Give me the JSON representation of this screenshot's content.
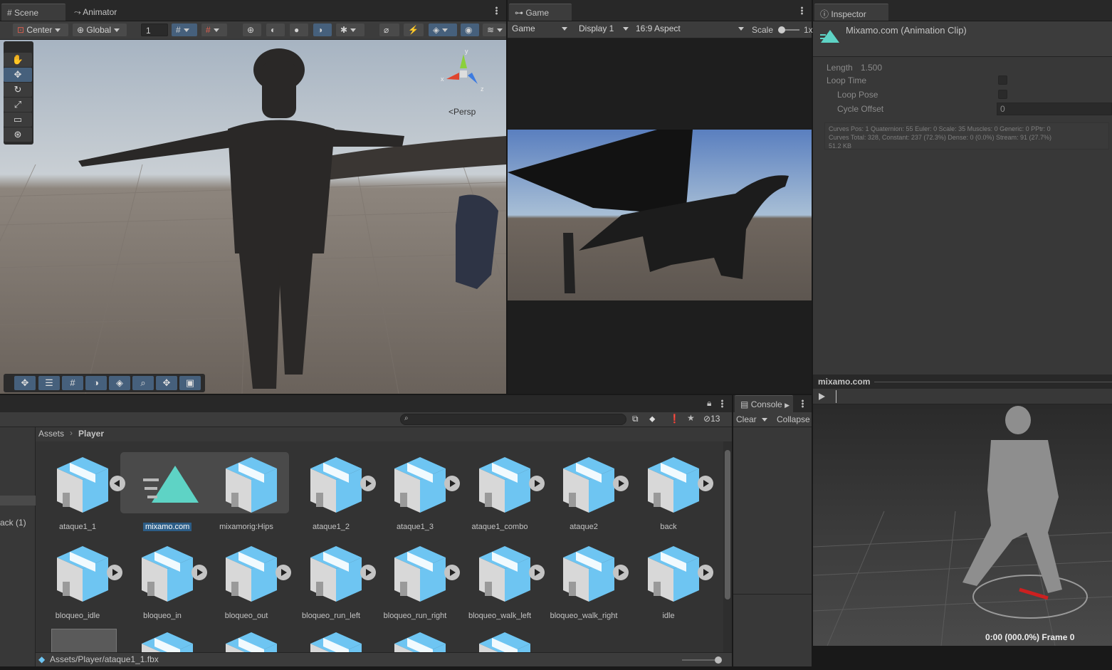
{
  "scene_panel": {
    "tabs": [
      {
        "label": "Scene",
        "icon": "grid-icon"
      },
      {
        "label": "Animator",
        "icon": "animator-icon"
      }
    ],
    "toolbar": {
      "pivot": "Center",
      "space": "Global",
      "snap_value": "1"
    },
    "persp_label": "<Persp",
    "gizmo_axes": {
      "y": "y",
      "x": "x",
      "z": "z"
    }
  },
  "game_panel": {
    "tab": "Game",
    "toolbar": {
      "mode": "Game",
      "display": "Display 1",
      "aspect": "16:9 Aspect",
      "scale_label": "Scale",
      "scale_value": "1x"
    }
  },
  "inspector": {
    "tab": "Inspector",
    "title": "Mixamo.com (Animation Clip)",
    "length_label": "Length",
    "length_value": "1.500",
    "loop_time_label": "Loop Time",
    "loop_pose_label": "Loop Pose",
    "cycle_offset_label": "Cycle Offset",
    "cycle_offset_value": "0",
    "stats_line1": "Curves Pos: 1 Quaternion: 55 Euler: 0 Scale: 35 Muscles: 0 Generic: 0 PPtr: 0",
    "stats_line2": "Curves Total: 328, Constant: 237 (72.3%) Dense: 0 (0.0%) Stream: 91 (27.7%)",
    "stats_line3": "51.2 KB",
    "preview_title": "mixamo.com",
    "preview_time": "0:00 (000.0%) Frame 0"
  },
  "project": {
    "hidden_count": "13",
    "breadcrumb": [
      "Assets",
      "Player"
    ],
    "left_list_item": "ack (1)",
    "status_path": "Assets/Player/ataque1_1.fbx",
    "assets_row1": [
      {
        "label": "ataque1_1",
        "type": "fbx"
      },
      {
        "label": "mixamo.com",
        "type": "clip"
      },
      {
        "label": "mixamorig:Hips",
        "type": "fbx"
      },
      {
        "label": "ataque1_2",
        "type": "fbx"
      },
      {
        "label": "ataque1_3",
        "type": "fbx"
      },
      {
        "label": "ataque1_combo",
        "type": "fbx"
      },
      {
        "label": "ataque2",
        "type": "fbx"
      },
      {
        "label": "back",
        "type": "fbx"
      }
    ],
    "assets_row2": [
      {
        "label": "bloqueo_idle"
      },
      {
        "label": "bloqueo_in"
      },
      {
        "label": "bloqueo_out"
      },
      {
        "label": "bloqueo_run_left"
      },
      {
        "label": "bloqueo_run_right"
      },
      {
        "label": "bloqueo_walk_left"
      },
      {
        "label": "bloqueo_walk_right"
      },
      {
        "label": "idle"
      }
    ]
  },
  "console": {
    "tab": "Console",
    "clear": "Clear",
    "collapse": "Collapse"
  },
  "colors": {
    "selection": "#2c5d87",
    "cube_blue": "#6ec5f2",
    "clip_teal": "#5ed3c5",
    "button_active": "#46607c"
  }
}
